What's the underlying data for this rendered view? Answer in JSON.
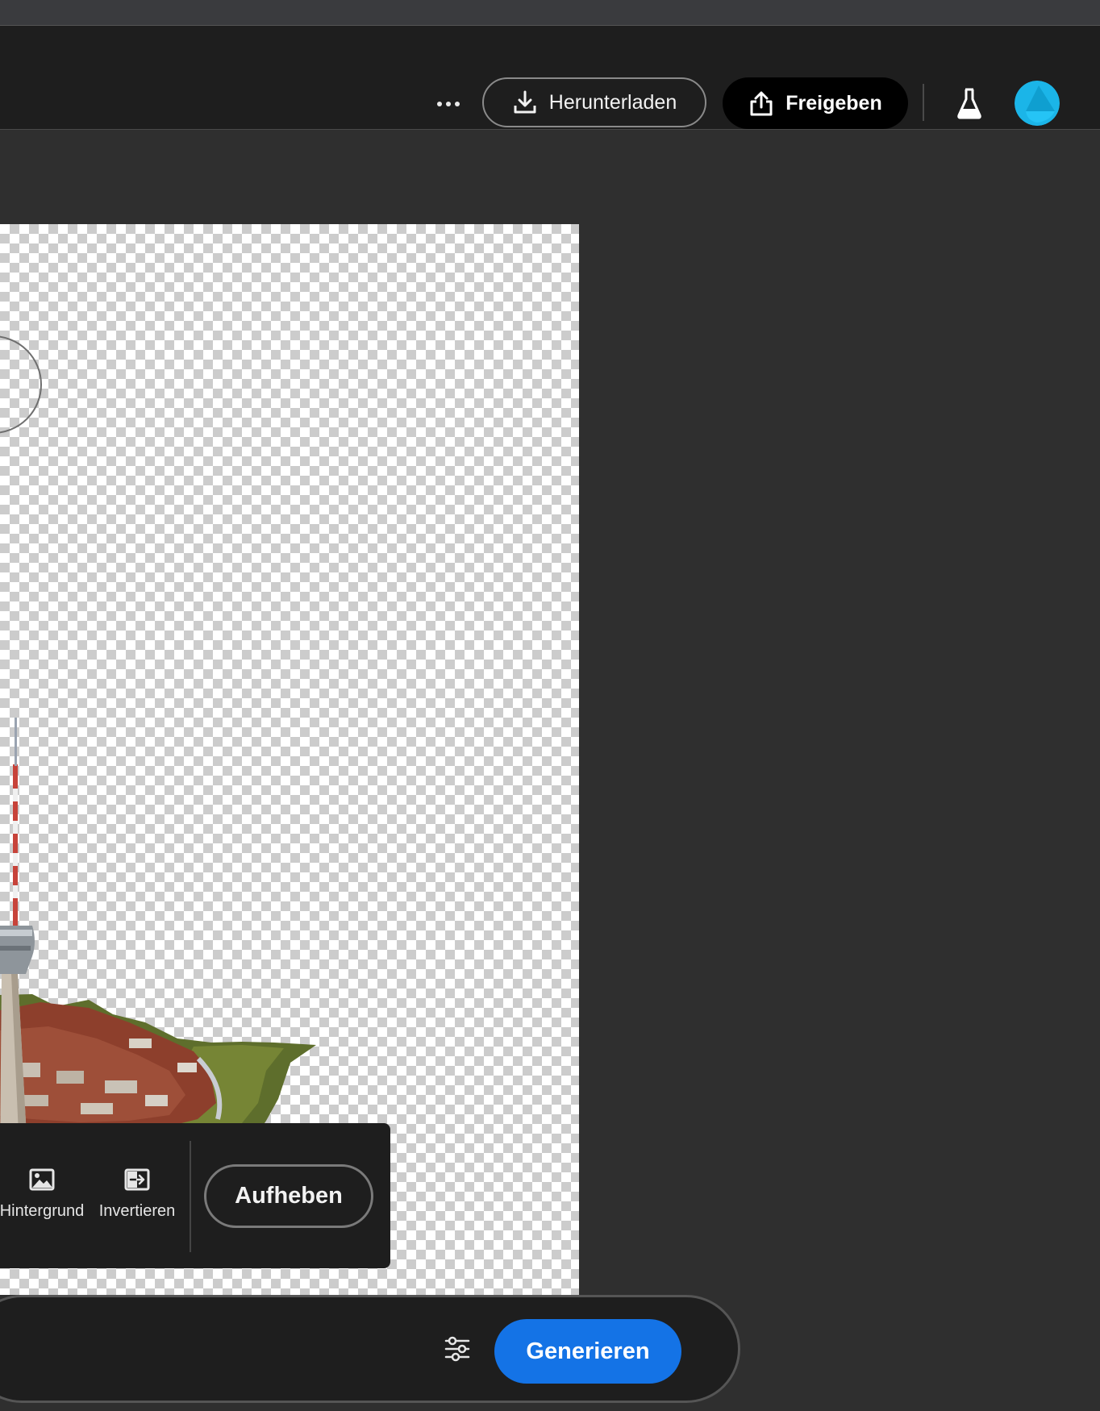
{
  "header": {
    "more_icon": "ellipsis-icon",
    "download_label": "Herunterladen",
    "download_icon": "download-icon",
    "share_label": "Freigeben",
    "share_icon": "share-icon",
    "labs_icon": "flask-icon",
    "avatar_color": "#1bb5e8"
  },
  "selection_toolbar": {
    "tools": [
      {
        "label": "Hintergrund",
        "icon": "image-icon"
      },
      {
        "label": "Invertieren",
        "icon": "invert-selection-icon"
      }
    ],
    "deselect_label": "Aufheben"
  },
  "prompt_bar": {
    "settings_icon": "sliders-icon",
    "generate_label": "Generieren",
    "generate_color": "#1473e6"
  }
}
